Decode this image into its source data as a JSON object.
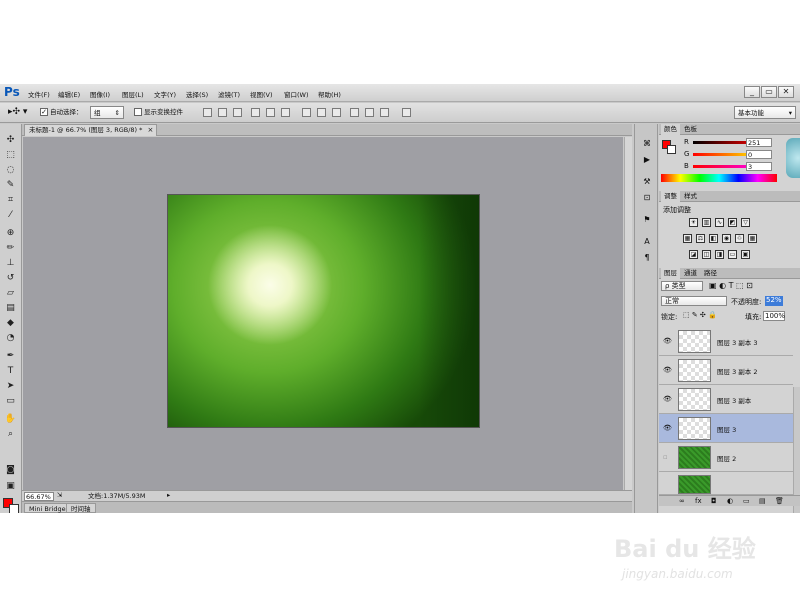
{
  "app": {
    "logo": "Ps"
  },
  "menu": [
    "文件(F)",
    "编辑(E)",
    "图像(I)",
    "图层(L)",
    "文字(Y)",
    "选择(S)",
    "滤镜(T)",
    "视图(V)",
    "窗口(W)",
    "帮助(H)"
  ],
  "window_controls": [
    "_",
    "▭",
    "✕"
  ],
  "options": {
    "auto_select_label": "自动选择：",
    "auto_select_value": "组",
    "show_transform_label": "显示变换控件",
    "workspace": "基本功能"
  },
  "document": {
    "tab_title": "未标题-1 @ 66.7% (图层 3, RGB/8) *",
    "tab_close": "×"
  },
  "status": {
    "zoom": "66.67%",
    "doc_size": "文档:1.37M/5.93M"
  },
  "bottom_tabs": [
    "Mini Bridge",
    "时间轴"
  ],
  "color_panel": {
    "tabs": [
      "颜色",
      "色板"
    ],
    "channels": [
      {
        "label": "R",
        "value": "251"
      },
      {
        "label": "G",
        "value": "0"
      },
      {
        "label": "B",
        "value": "3"
      }
    ]
  },
  "adjust_panel": {
    "tabs": [
      "调整",
      "样式"
    ],
    "title": "添加调整"
  },
  "layers_panel": {
    "tabs": [
      "图层",
      "通道",
      "路径"
    ],
    "filter_kind": "ρ 类型",
    "blend_mode": "正常",
    "opacity_label": "不透明度:",
    "opacity_value": "52%",
    "lock_label": "锁定:",
    "fill_label": "填充:",
    "fill_value": "100%",
    "layers": [
      {
        "name": "图层 3 副本 3",
        "visible": true,
        "selected": false,
        "thumb": "transparent"
      },
      {
        "name": "图层 3 副本 2",
        "visible": true,
        "selected": false,
        "thumb": "transparent"
      },
      {
        "name": "图层 3 副本",
        "visible": true,
        "selected": false,
        "thumb": "transparent"
      },
      {
        "name": "图层 3",
        "visible": true,
        "selected": true,
        "thumb": "transparent"
      },
      {
        "name": "图层 2",
        "visible": false,
        "selected": false,
        "thumb": "green"
      }
    ],
    "footer_icons": [
      "∞",
      "fx",
      "◘",
      "◐",
      "▭",
      "▤",
      "🗑"
    ]
  },
  "watermark": {
    "text": "Bai du 经验",
    "url": "jingyan.baidu.com"
  },
  "colors": {
    "foreground": "#ff0000",
    "background": "#ffffff",
    "selected_layer": "#a9b9dd"
  }
}
